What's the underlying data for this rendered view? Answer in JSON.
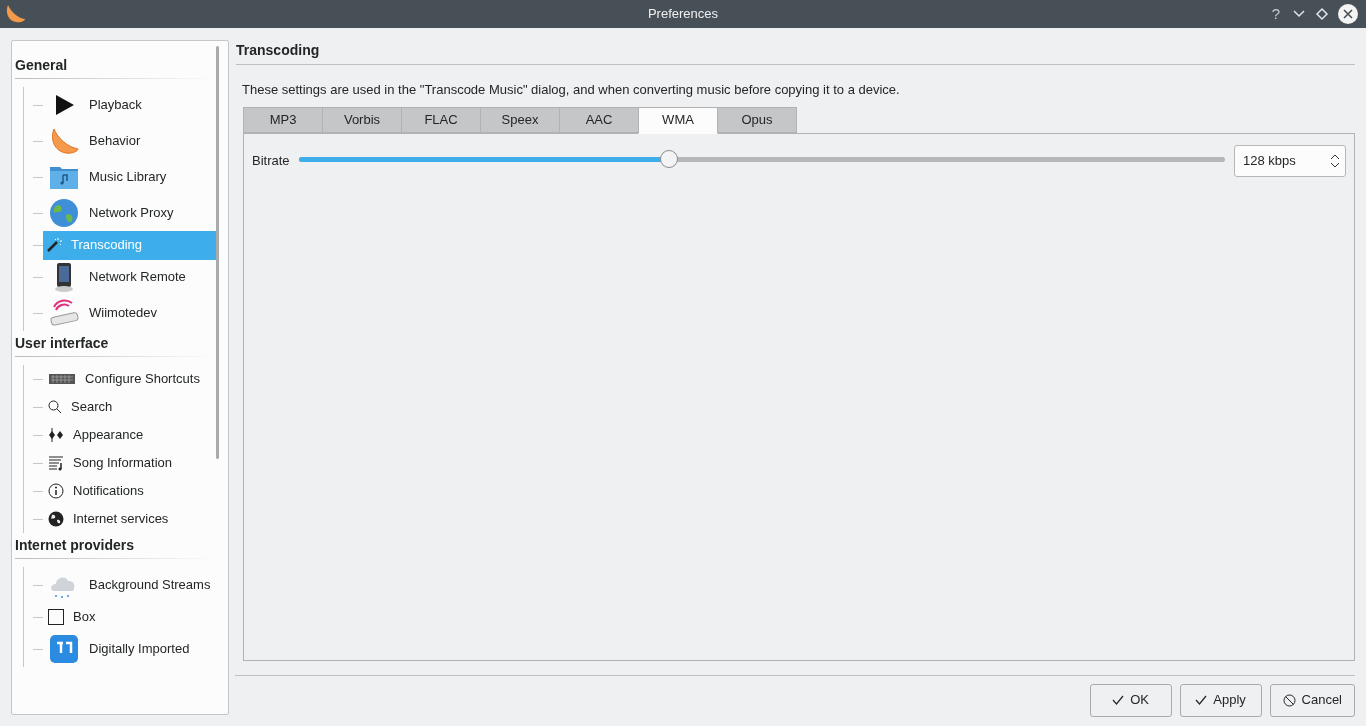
{
  "window": {
    "title": "Preferences",
    "controls": [
      "?"
    ]
  },
  "sidebar": {
    "sections": [
      {
        "title": "General",
        "items": [
          {
            "label": "Playback",
            "selected": false
          },
          {
            "label": "Behavior",
            "selected": false
          },
          {
            "label": "Music Library",
            "selected": false
          },
          {
            "label": "Network Proxy",
            "selected": false
          },
          {
            "label": "Transcoding",
            "selected": true
          },
          {
            "label": "Network Remote",
            "selected": false
          },
          {
            "label": "Wiimotedev",
            "selected": false
          }
        ]
      },
      {
        "title": "User interface",
        "items": [
          {
            "label": "Configure Shortcuts",
            "selected": false
          },
          {
            "label": "Search",
            "selected": false
          },
          {
            "label": "Appearance",
            "selected": false
          },
          {
            "label": "Song Information",
            "selected": false
          },
          {
            "label": "Notifications",
            "selected": false
          },
          {
            "label": "Internet services",
            "selected": false
          }
        ]
      },
      {
        "title": "Internet providers",
        "items": [
          {
            "label": "Background Streams",
            "selected": false
          },
          {
            "label": "Box",
            "selected": false
          },
          {
            "label": "Digitally Imported",
            "selected": false
          }
        ]
      }
    ]
  },
  "page": {
    "title": "Transcoding",
    "description": "These settings are used in the \"Transcode Music\" dialog, and when converting music before copying it to a device.",
    "tabs": [
      {
        "label": "MP3",
        "selected": false
      },
      {
        "label": "Vorbis",
        "selected": false
      },
      {
        "label": "FLAC",
        "selected": false
      },
      {
        "label": "Speex",
        "selected": false
      },
      {
        "label": "AAC",
        "selected": false
      },
      {
        "label": "WMA",
        "selected": true
      },
      {
        "label": "Opus",
        "selected": false
      }
    ],
    "bitrate": {
      "label": "Bitrate",
      "level": 0.4,
      "value": "128 kbps"
    }
  },
  "buttons": [
    {
      "label": "OK",
      "kind": "ok"
    },
    {
      "label": "Apply",
      "kind": "apply"
    },
    {
      "label": "Cancel",
      "kind": "cancel"
    }
  ]
}
